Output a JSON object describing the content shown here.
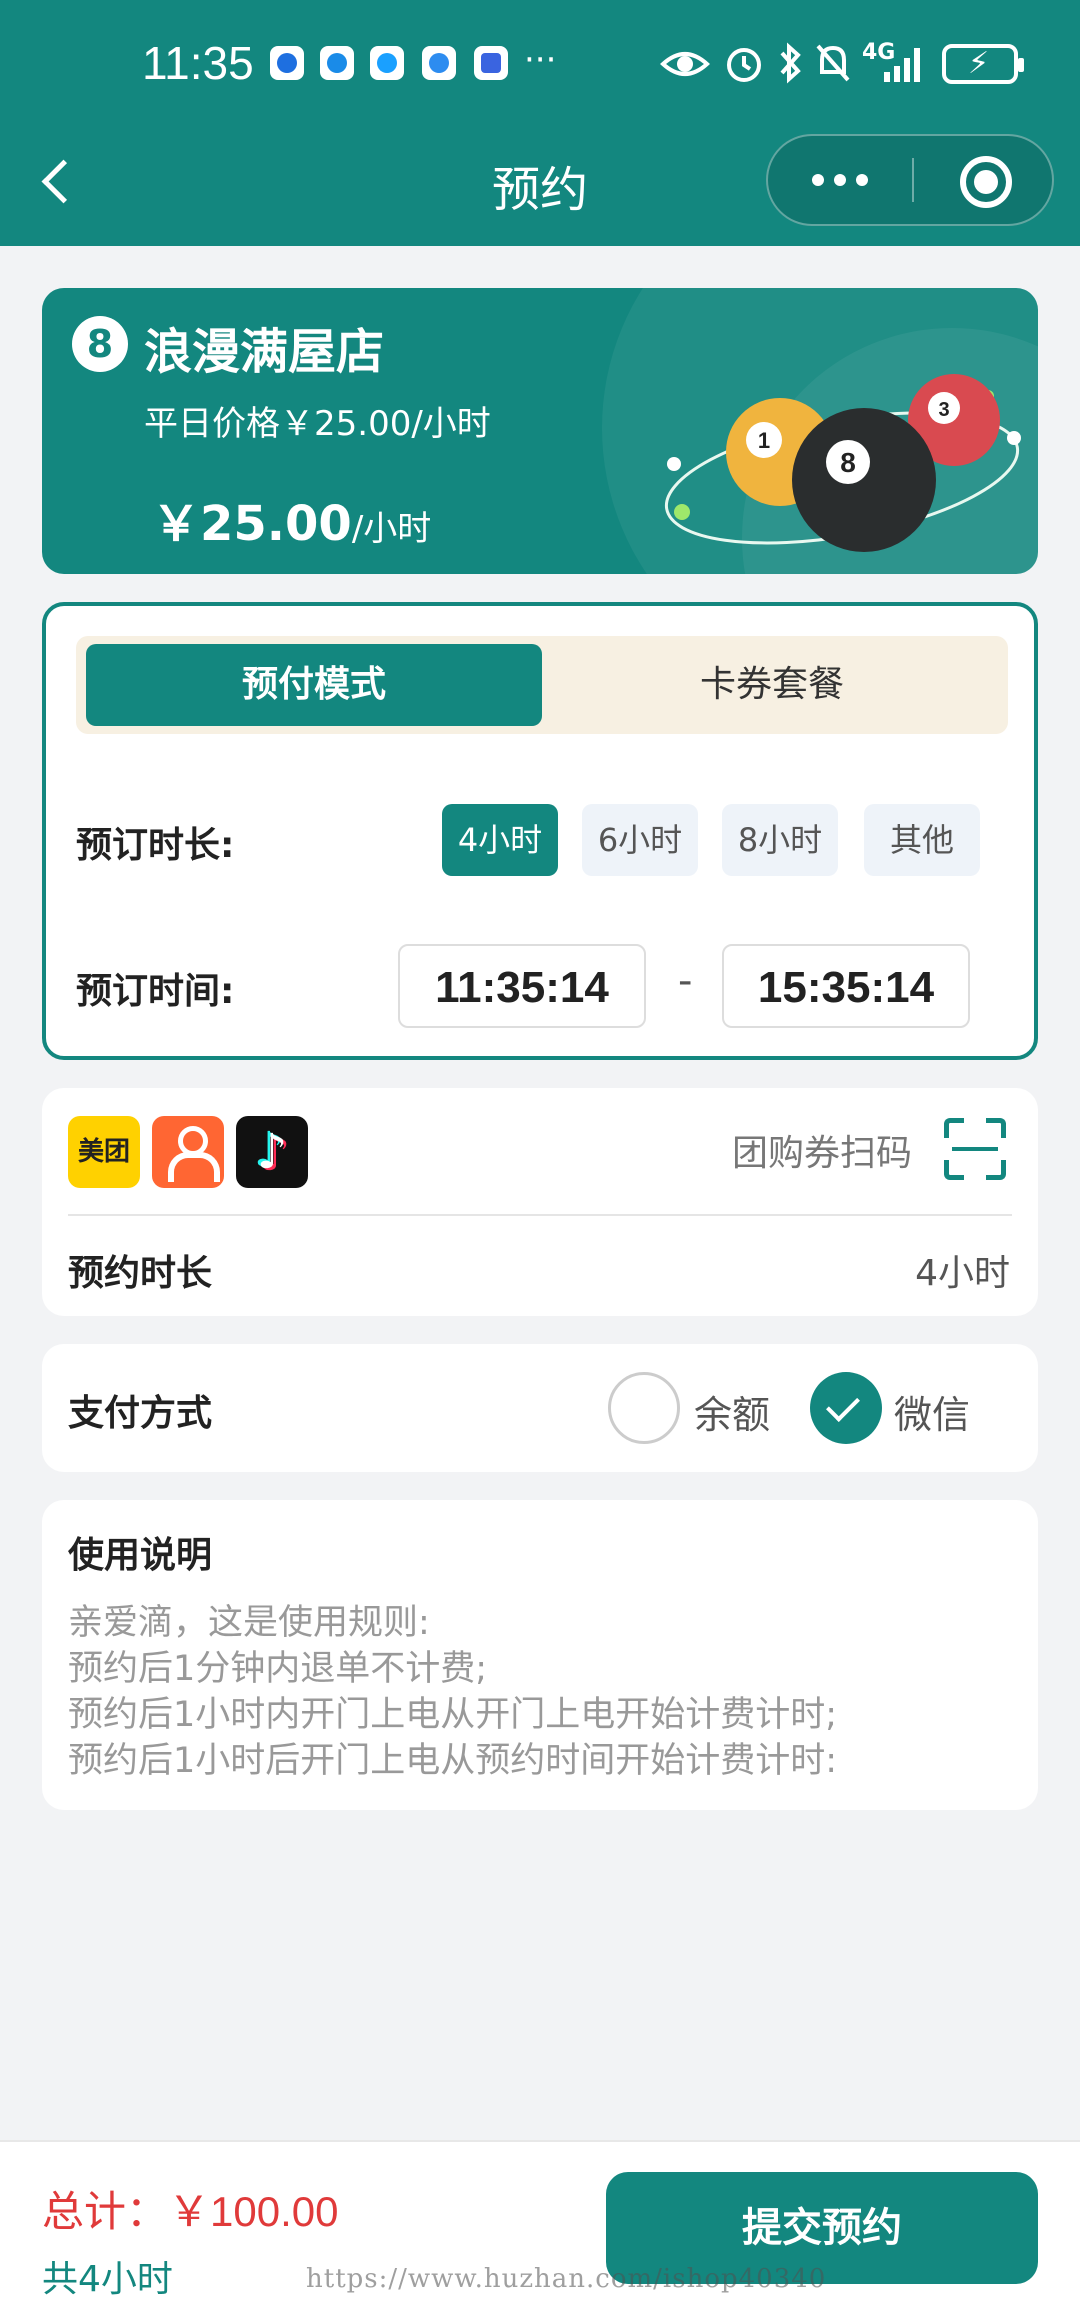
{
  "status_bar": {
    "time": "11:35",
    "dots": "···",
    "network": "4G",
    "battery_icon": "charging-battery-icon",
    "app_icons": [
      "flag-icon",
      "shield-icon",
      "chat-icon",
      "ball-icon",
      "traffic-app-icon"
    ]
  },
  "header": {
    "title": "预约",
    "back_icon": "chevron-left-icon",
    "more_icon": "more-dots-icon",
    "close_icon": "target-circle-icon"
  },
  "store": {
    "logo_glyph": "8",
    "name": "浪漫满屋店",
    "weekday_price": "平日价格￥25.00/小时",
    "price_big": "￥25.00",
    "price_unit": "/小时",
    "ball_labels": [
      "1",
      "8",
      "3"
    ]
  },
  "booking": {
    "tabs": [
      "预付模式",
      "卡券套餐"
    ],
    "active_tab": "预付模式",
    "duration_label": "预订时长:",
    "duration_options": [
      "4小时",
      "6小时",
      "8小时",
      "其他"
    ],
    "selected_duration": "4小时",
    "time_label": "预订时间:",
    "start_time": "11:35:14",
    "separator": "-",
    "end_time": "15:35:14"
  },
  "coupon": {
    "platforms": [
      "美团",
      "dianping-icon",
      "douyin-icon"
    ],
    "meituan_text": "美团",
    "scan_label": "团购券扫码",
    "duration_label": "预约时长",
    "duration_value": "4小时"
  },
  "payment": {
    "label": "支付方式",
    "options": [
      "余额",
      "微信"
    ],
    "selected": "微信"
  },
  "instructions": {
    "title": "使用说明",
    "lines": [
      "亲爱滴，这是使用规则:",
      "预约后1分钟内退单不计费;",
      "预约后1小时内开门上电从开门上电开始计费计时;",
      "预约后1小时后开门上电从预约时间开始计费计时:"
    ]
  },
  "footer": {
    "total": "总计：￥100.00",
    "hours": "共4小时",
    "submit": "提交预约",
    "watermark": "https://www.huzhan.com/ishop40340"
  },
  "colors": {
    "primary": "#13877f",
    "accent_red": "#e03a3a",
    "tab_bg": "#f7f0e2",
    "page_bg": "#f2f3f5"
  }
}
